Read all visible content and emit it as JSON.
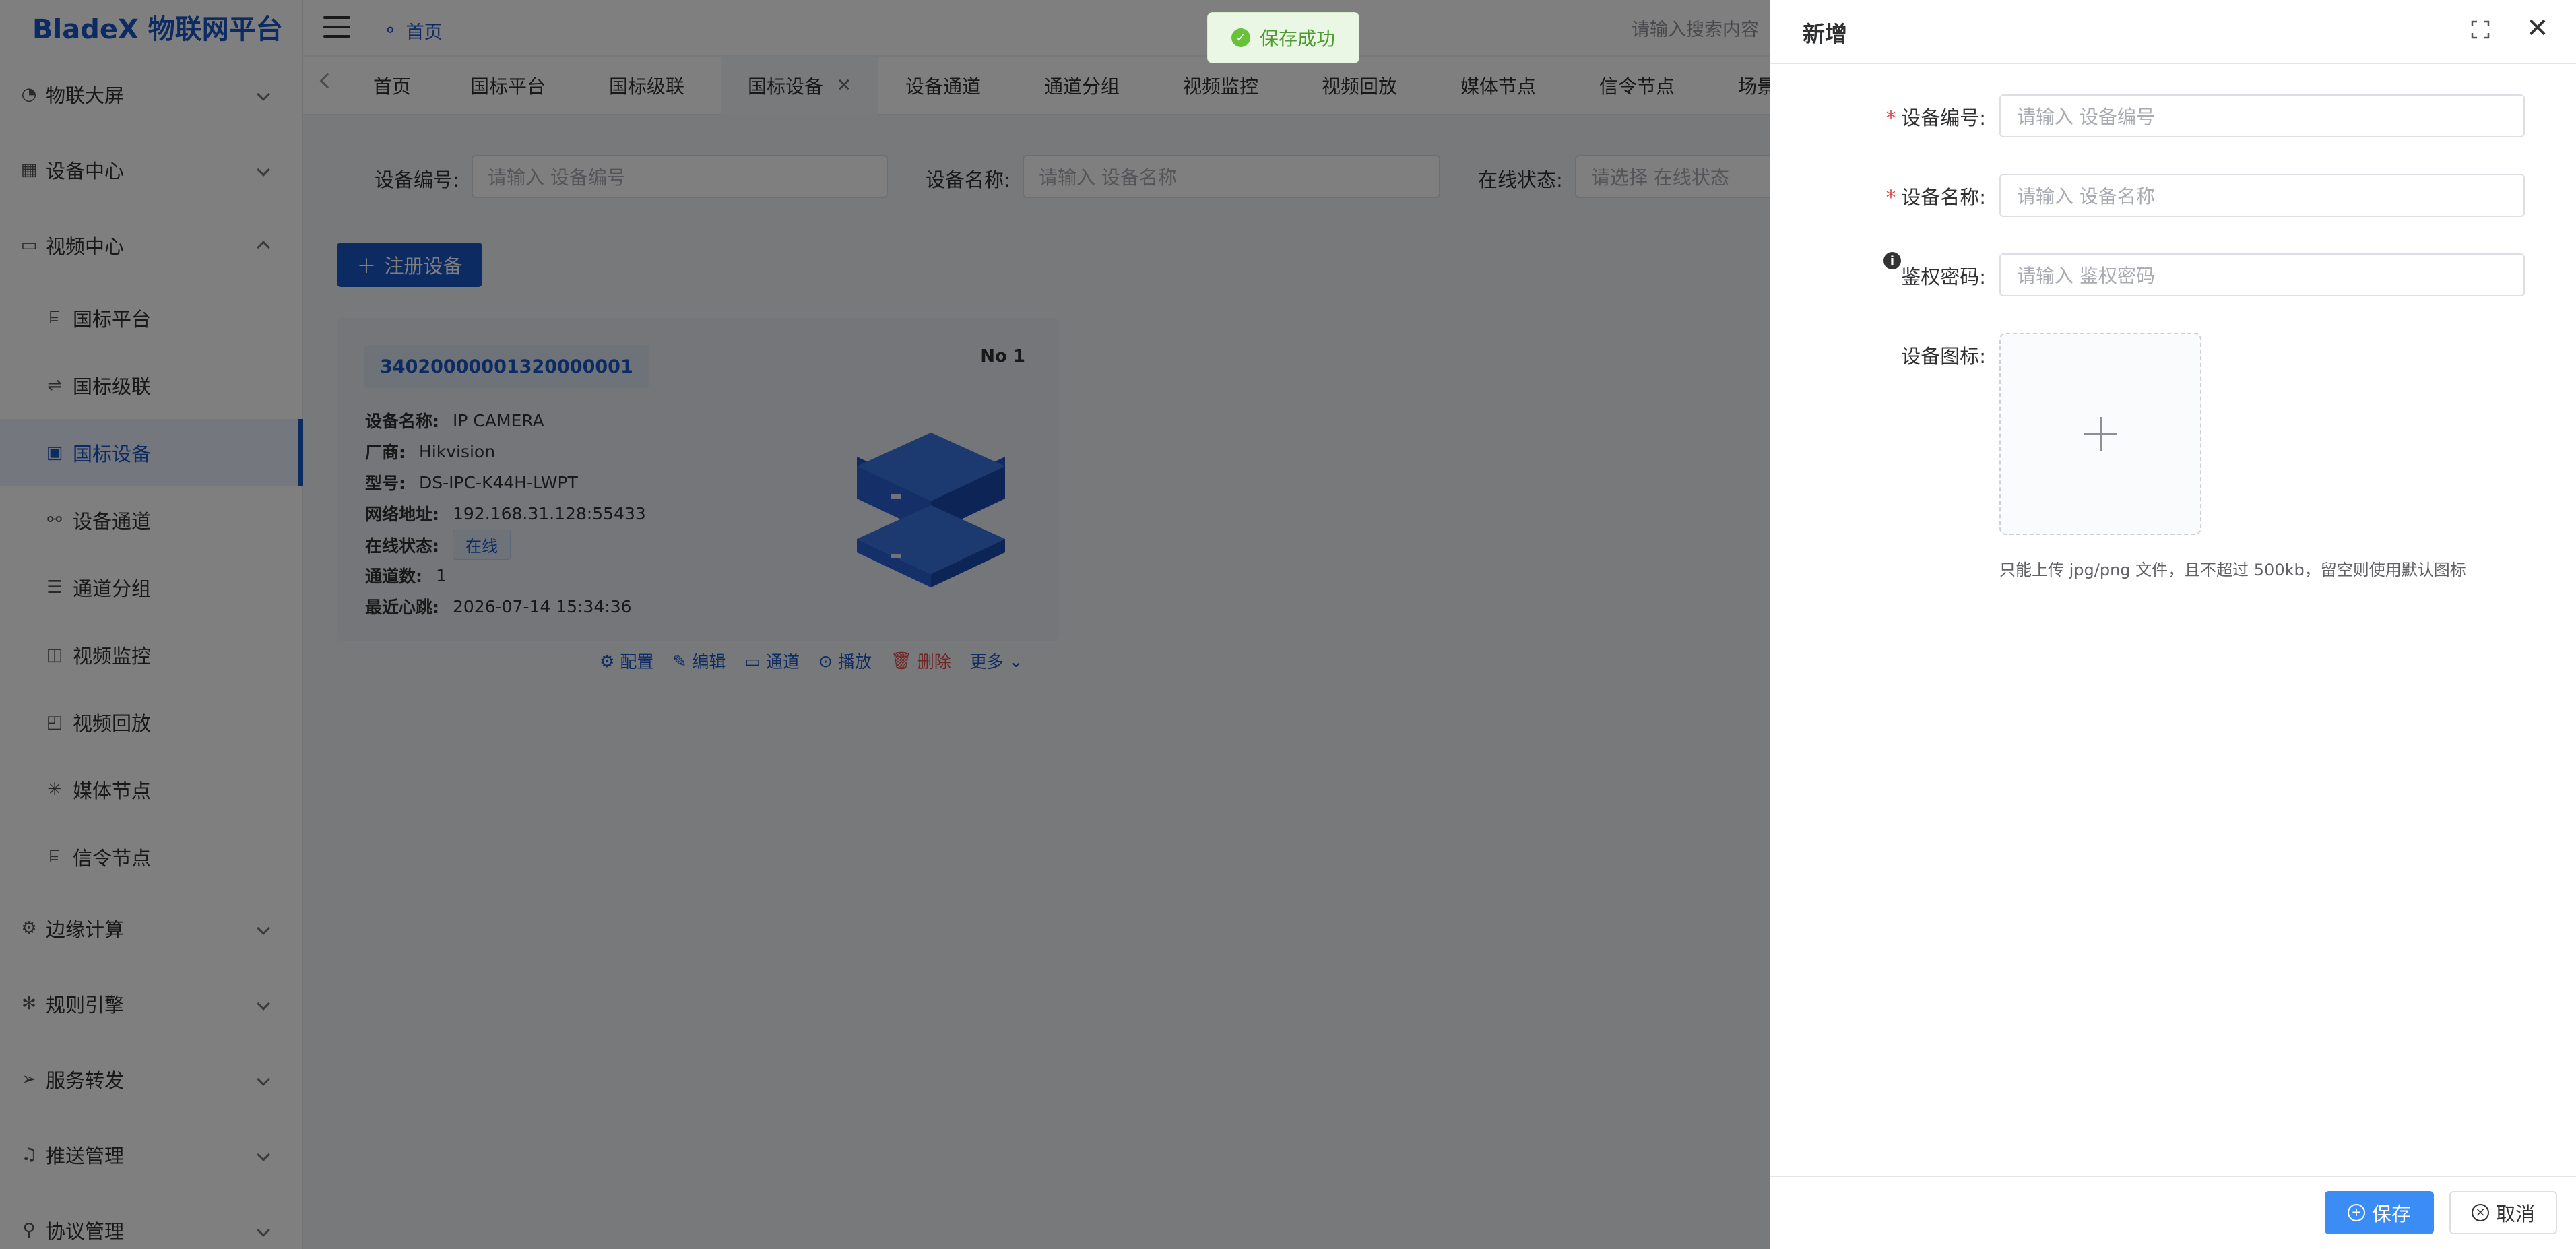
{
  "app": {
    "logo": "BladeX 物联网平台"
  },
  "header": {
    "breadcrumb": "首页",
    "search_placeholder": "请输入搜索内容"
  },
  "toast": {
    "message": "保存成功"
  },
  "sidebar": {
    "groups": [
      {
        "label": "物联大屏"
      },
      {
        "label": "设备中心"
      },
      {
        "label": "视频中心"
      },
      {
        "label": "边缘计算"
      },
      {
        "label": "规则引擎"
      },
      {
        "label": "服务转发"
      },
      {
        "label": "推送管理"
      },
      {
        "label": "协议管理"
      }
    ],
    "video_items": [
      {
        "label": "国标平台"
      },
      {
        "label": "国标级联"
      },
      {
        "label": "国标设备"
      },
      {
        "label": "设备通道"
      },
      {
        "label": "通道分组"
      },
      {
        "label": "视频监控"
      },
      {
        "label": "视频回放"
      },
      {
        "label": "媒体节点"
      },
      {
        "label": "信令节点"
      }
    ]
  },
  "tabs": [
    {
      "label": "首页"
    },
    {
      "label": "国标平台"
    },
    {
      "label": "国标级联"
    },
    {
      "label": "国标设备"
    },
    {
      "label": "设备通道"
    },
    {
      "label": "通道分组"
    },
    {
      "label": "视频监控"
    },
    {
      "label": "视频回放"
    },
    {
      "label": "媒体节点"
    },
    {
      "label": "信令节点"
    },
    {
      "label": "场景"
    }
  ],
  "filters": {
    "device_code_label": "设备编号:",
    "device_code_placeholder": "请输入 设备编号",
    "device_name_label": "设备名称:",
    "device_name_placeholder": "请输入 设备名称",
    "online_label": "在线状态:",
    "online_placeholder": "请选择 在线状态"
  },
  "register_button": "注册设备",
  "card": {
    "id": "34020000001320000001",
    "no": "No 1",
    "rows": [
      {
        "k": "设备名称:",
        "v": "IP CAMERA"
      },
      {
        "k": "厂商:",
        "v": "Hikvision"
      },
      {
        "k": "型号:",
        "v": "DS-IPC-K44H-LWPT"
      },
      {
        "k": "网络地址:",
        "v": "192.168.31.128:55433"
      },
      {
        "k": "在线状态:",
        "v": "在线"
      },
      {
        "k": "通道数:",
        "v": "1"
      },
      {
        "k": "最近心跳:",
        "v": "2026-07-14 15:34:36"
      }
    ],
    "actions": {
      "config": "配置",
      "edit": "编辑",
      "channel": "通道",
      "play": "播放",
      "delete": "删除",
      "more": "更多"
    }
  },
  "drawer": {
    "title": "新增",
    "fields": {
      "code_label": "设备编号:",
      "code_placeholder": "请输入 设备编号",
      "name_label": "设备名称:",
      "name_placeholder": "请输入 设备名称",
      "password_label": "鉴权密码:",
      "password_placeholder": "请输入 鉴权密码",
      "icon_label": "设备图标:"
    },
    "upload_tip": "只能上传 jpg/png 文件，且不超过 500kb，留空则使用默认图标",
    "save_label": "保存",
    "cancel_label": "取消"
  },
  "colors": {
    "primary": "#1a56c6",
    "save": "#3b8cf5",
    "danger": "#e04848",
    "success": "#67c23a"
  }
}
